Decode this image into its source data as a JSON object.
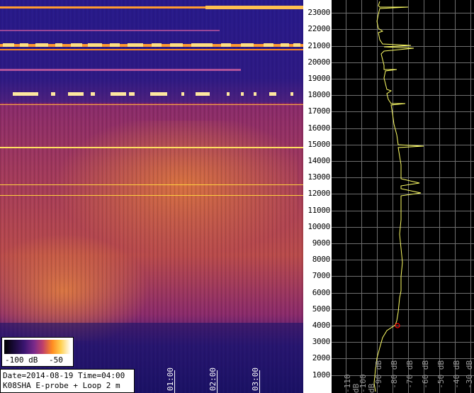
{
  "info": {
    "date_line": "Date=2014-08-19 Time=04:00",
    "station_line": "K08SHA E-probe + Loop 2 m"
  },
  "legend": {
    "min_label": "-100 dB",
    "max_label": "-50"
  },
  "time_axis": {
    "labels": [
      "01:00",
      "02:00",
      "03:00"
    ]
  },
  "frequency_axis": {
    "labels": [
      "23000",
      "22000",
      "21000",
      "20000",
      "19000",
      "18000",
      "17000",
      "16000",
      "15000",
      "14000",
      "13000",
      "12000",
      "11000",
      "10000",
      "9000",
      "8000",
      "7000",
      "6000",
      "5000",
      "4000",
      "3000",
      "2000",
      "1000"
    ]
  },
  "spectrum_axis": {
    "labels": [
      "-110 dB",
      "-100 dB",
      "-90 dB",
      "-80 dB",
      "-70 dB",
      "-60 dB",
      "-50 dB",
      "-40 dB",
      "-30 dB"
    ]
  },
  "colors": {
    "spectrum_trace": "#ffff66",
    "grid": "#808080",
    "marker": "#ff0000",
    "signal_line": "#ffd24a"
  }
}
